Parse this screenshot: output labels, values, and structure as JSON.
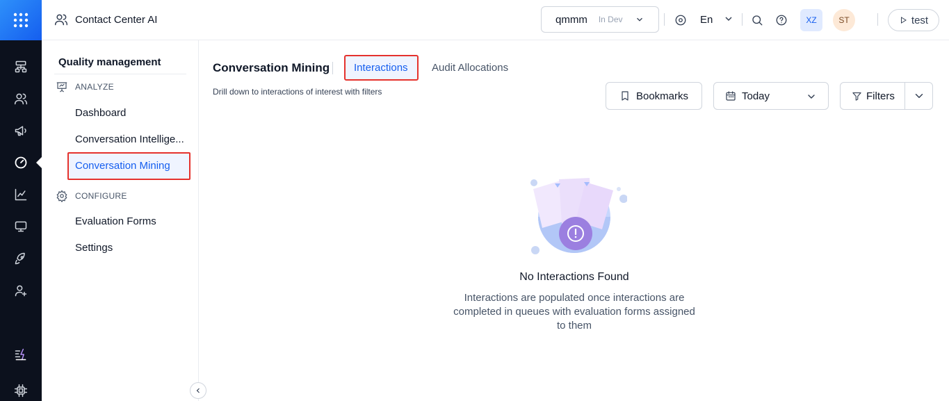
{
  "app": {
    "title": "Contact Center AI"
  },
  "workspace": {
    "name": "qmmm",
    "env": "In Dev"
  },
  "header": {
    "language": "En",
    "avatar_user": "XZ",
    "avatar_alt": "ST",
    "test_label": "test"
  },
  "sidebar": {
    "title": "Quality management",
    "sections": [
      {
        "label": "ANALYZE",
        "icon": "presentation-chart-icon"
      },
      {
        "label": "CONFIGURE",
        "icon": "gear-icon"
      }
    ],
    "items": [
      {
        "label": "Dashboard"
      },
      {
        "label": "Conversation Intellige..."
      },
      {
        "label": "Conversation Mining"
      },
      {
        "label": "Evaluation Forms"
      },
      {
        "label": "Settings"
      }
    ]
  },
  "main": {
    "title": "Conversation Mining",
    "tabs": [
      {
        "label": "Interactions"
      },
      {
        "label": "Audit Allocations"
      }
    ],
    "subtitle": "Drill down to interactions of interest with filters",
    "buttons": {
      "bookmarks": "Bookmarks",
      "date_range": "Today",
      "filters": "Filters"
    },
    "empty": {
      "title": "No Interactions Found",
      "description": "Interactions are populated once interactions are completed in queues with evaluation forms assigned to them"
    }
  },
  "colors": {
    "accent": "#155eef",
    "highlight": "#e5322d",
    "rail": "#0c111d"
  }
}
